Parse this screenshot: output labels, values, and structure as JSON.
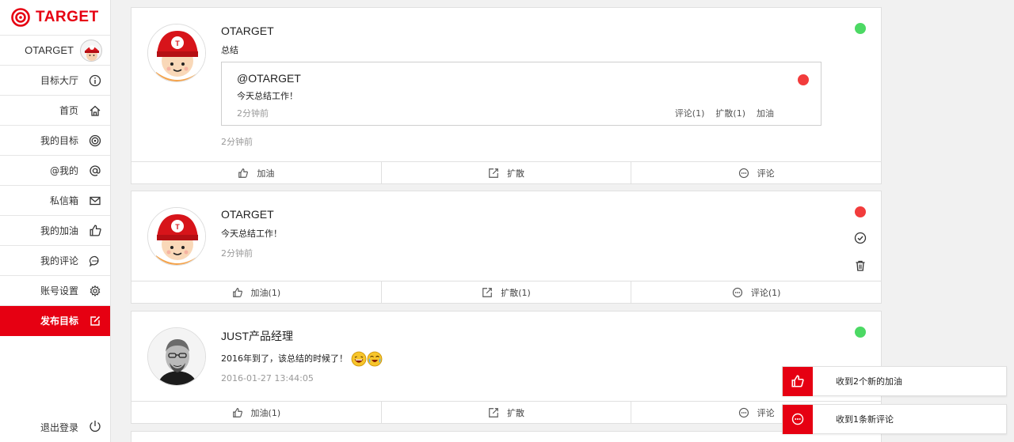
{
  "brand": {
    "name": "TARGET",
    "accent": "#e60012"
  },
  "sidebar": {
    "user_name": "OTARGET",
    "items": [
      {
        "label": "目标大厅",
        "icon": "info-icon"
      },
      {
        "label": "首页",
        "icon": "home-icon"
      },
      {
        "label": "我的目标",
        "icon": "target-icon"
      },
      {
        "label": "@我的",
        "icon": "at-icon"
      },
      {
        "label": "私信箱",
        "icon": "mail-icon"
      },
      {
        "label": "我的加油",
        "icon": "thumbs-up-icon"
      },
      {
        "label": "我的评论",
        "icon": "comment-icon"
      },
      {
        "label": "账号设置",
        "icon": "gear-icon"
      },
      {
        "label": "发布目标",
        "icon": "edit-icon",
        "active": true
      }
    ],
    "logout_label": "退出登录"
  },
  "feed": [
    {
      "author": "OTARGET",
      "content": "总结",
      "time": "2分钟前",
      "status_color": "#4cd964",
      "quote": {
        "author": "@OTARGET",
        "content": "今天总结工作！",
        "time": "2分钟前",
        "comment_label": "评论(1)",
        "share_label": "扩散(1)",
        "cheer_label": "加油",
        "status_color": "#f23c3c"
      },
      "actions": {
        "cheer": "加油",
        "share": "扩散",
        "comment": "评论"
      }
    },
    {
      "author": "OTARGET",
      "content": "今天总结工作！",
      "time": "2分钟前",
      "status_color": "#f23c3c",
      "actions": {
        "cheer": "加油(1)",
        "share": "扩散(1)",
        "comment": "评论(1)"
      }
    },
    {
      "author": "JUST产品经理",
      "content": "2016年到了，该总结的时候了！",
      "time": "2016-01-27 13:44:05",
      "status_color": "#4cd964",
      "actions": {
        "cheer": "加油(1)",
        "share": "扩散",
        "comment": "评论"
      }
    }
  ],
  "notifications": [
    {
      "text": "收到2个新的加油",
      "icon": "thumbs-up-icon"
    },
    {
      "text": "收到1条新评论",
      "icon": "comment-icon"
    }
  ]
}
